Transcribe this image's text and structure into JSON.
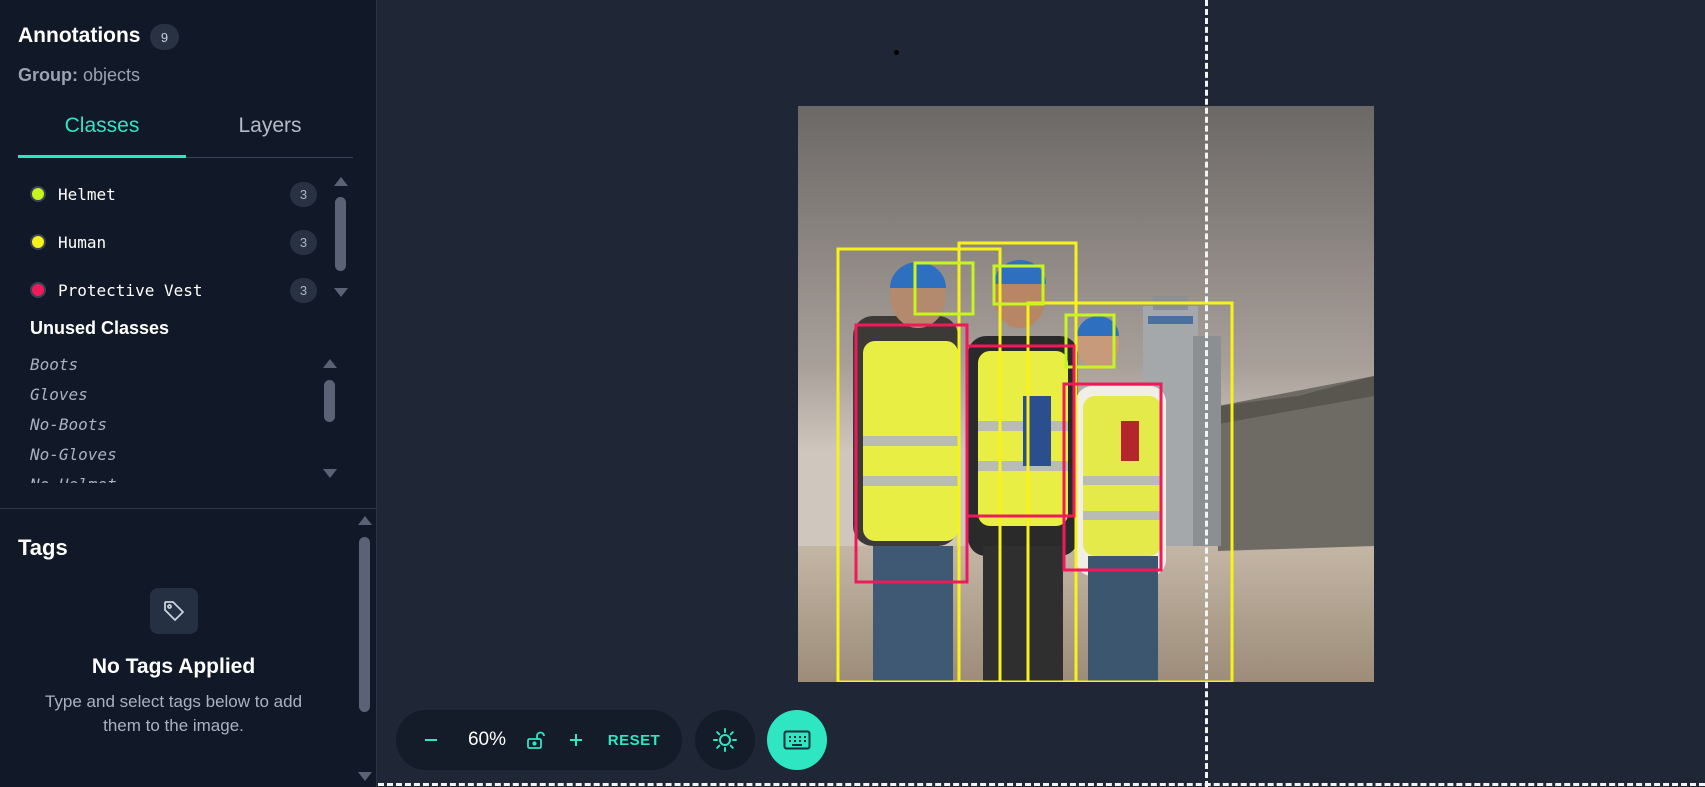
{
  "sidebar": {
    "title": "Annotations",
    "annotation_count": "9",
    "group_label": "Group:",
    "group_value": "objects",
    "tabs": [
      {
        "label": "Classes",
        "active": true
      },
      {
        "label": "Layers",
        "active": false
      }
    ],
    "classes": [
      {
        "name": "Helmet",
        "count": "3",
        "color": "#c6f51f"
      },
      {
        "name": "Human",
        "count": "3",
        "color": "#f7f21a"
      },
      {
        "name": "Protective Vest",
        "count": "3",
        "color": "#f0195a"
      }
    ],
    "unused_title": "Unused Classes",
    "unused_classes": [
      "Boots",
      "Gloves",
      "No-Boots",
      "No-Gloves",
      "No-Helmet"
    ]
  },
  "tags": {
    "title": "Tags",
    "icon": "tag-icon",
    "empty_title": "No Tags Applied",
    "empty_desc": "Type and select tags below to add them to the image."
  },
  "toolbar": {
    "zoom_out_icon": "minus-icon",
    "zoom_value": "60%",
    "lock_icon": "unlock-icon",
    "zoom_in_icon": "plus-icon",
    "reset_label": "RESET",
    "brightness_icon": "sun-icon",
    "keyboard_icon": "keyboard-icon"
  },
  "colors": {
    "accent": "#2ee6c1",
    "helmet": "#c6f51f",
    "human": "#f7f21a",
    "vest": "#f0195a"
  }
}
